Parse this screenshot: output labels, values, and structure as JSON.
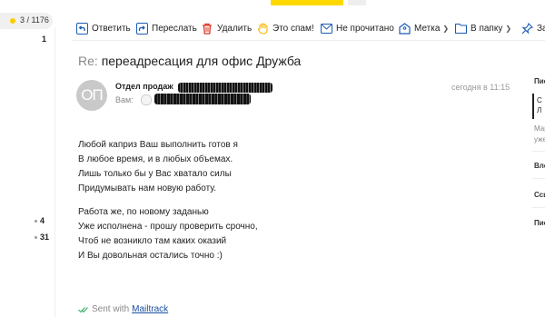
{
  "folders": {
    "active_count": "3 / 1176",
    "counts": [
      "1",
      "4",
      "31"
    ]
  },
  "toolbar": {
    "reply": "Ответить",
    "forward": "Переслать",
    "delete": "Удалить",
    "spam": "Это спам!",
    "unread": "Не прочитано",
    "label": "Метка",
    "to_folder": "В папку",
    "pin": "За"
  },
  "message": {
    "subject_prefix": "Re:",
    "subject": "переадресация для офис Дружба",
    "avatar_initials": "ОП",
    "sender_name": "Отдел продаж",
    "to_label": "Вам:",
    "date": "сегодня в 11:15",
    "body_para1": [
      "Любой каприз Ваш выполнить готов я",
      "В любое время, и в любых объемах.",
      "Лишь только бы у Вас хватало силы",
      "Придумывать нам новую работу."
    ],
    "body_para2": [
      "Работа же, по новому заданью",
      "Уже исполнена - прошу проверить срочно,",
      "Чтоб не возникло там каких оказий",
      "И Вы довольная остались точно :)"
    ],
    "sent_with": "Sent with",
    "mailtrack": "Mailtrack"
  },
  "right_sidebar": {
    "items": [
      "Пис",
      "С",
      "Л",
      "Мар",
      "уже",
      "Вло",
      "Ссы",
      "Пис"
    ]
  },
  "colors": {
    "toolbar_icon": "#1a5bb5",
    "delete_icon": "#d9331f",
    "spam_icon": "#f5b800",
    "link": "#1a4fa3",
    "accent_yellow": "#ffd800"
  }
}
